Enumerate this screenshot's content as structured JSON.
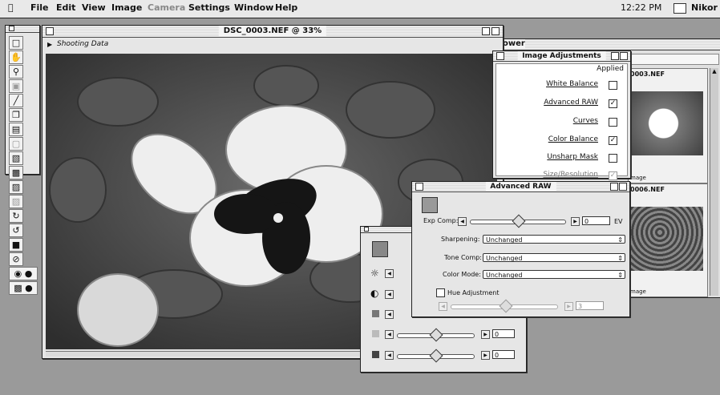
{
  "menubar": {
    "items": [
      "File",
      "Edit",
      "View",
      "Image",
      "Camera",
      "Settings",
      "Window",
      "Help"
    ],
    "disabled": [
      "Camera"
    ],
    "clock": "12:22 PM",
    "app_name": "Nikor"
  },
  "image_window": {
    "title": "DSC_0003.NEF @ 33%",
    "shooting_data_label": "Shooting Data"
  },
  "browser": {
    "title_fragment": "ower",
    "thumbs": [
      {
        "name": "0003.NEF",
        "caption": "mage"
      },
      {
        "name": "0006.NEF",
        "caption": "mage"
      }
    ]
  },
  "image_adjustments": {
    "title": "Image Adjustments",
    "applied_header": "Applied",
    "rows": [
      {
        "label": "White Balance",
        "checked": false
      },
      {
        "label": "Advanced RAW",
        "checked": true
      },
      {
        "label": "Curves",
        "checked": false
      },
      {
        "label": "Color Balance",
        "checked": true
      },
      {
        "label": "Unsharp Mask",
        "checked": false
      },
      {
        "label": "Size/Resolution",
        "checked": true,
        "dimmed": true
      }
    ]
  },
  "advanced_raw": {
    "title": "Advanced RAW",
    "exp_comp_label": "Exp Comp:",
    "exp_comp_value": "0",
    "exp_comp_unit": "EV",
    "sharpening_label": "Sharpening:",
    "sharpening_value": "Unchanged",
    "tone_comp_label": "Tone Comp:",
    "tone_comp_value": "Unchanged",
    "color_mode_label": "Color Mode:",
    "color_mode_value": "Unchanged",
    "hue_label": "Hue Adjustment",
    "hue_value": "3"
  },
  "color_balance": {
    "values": [
      "0",
      "0"
    ]
  },
  "colors": {
    "menubar_bg": "#e9e9e9",
    "desktop_bg": "#9a9a9a",
    "panel_bg": "#e6e6e6"
  }
}
